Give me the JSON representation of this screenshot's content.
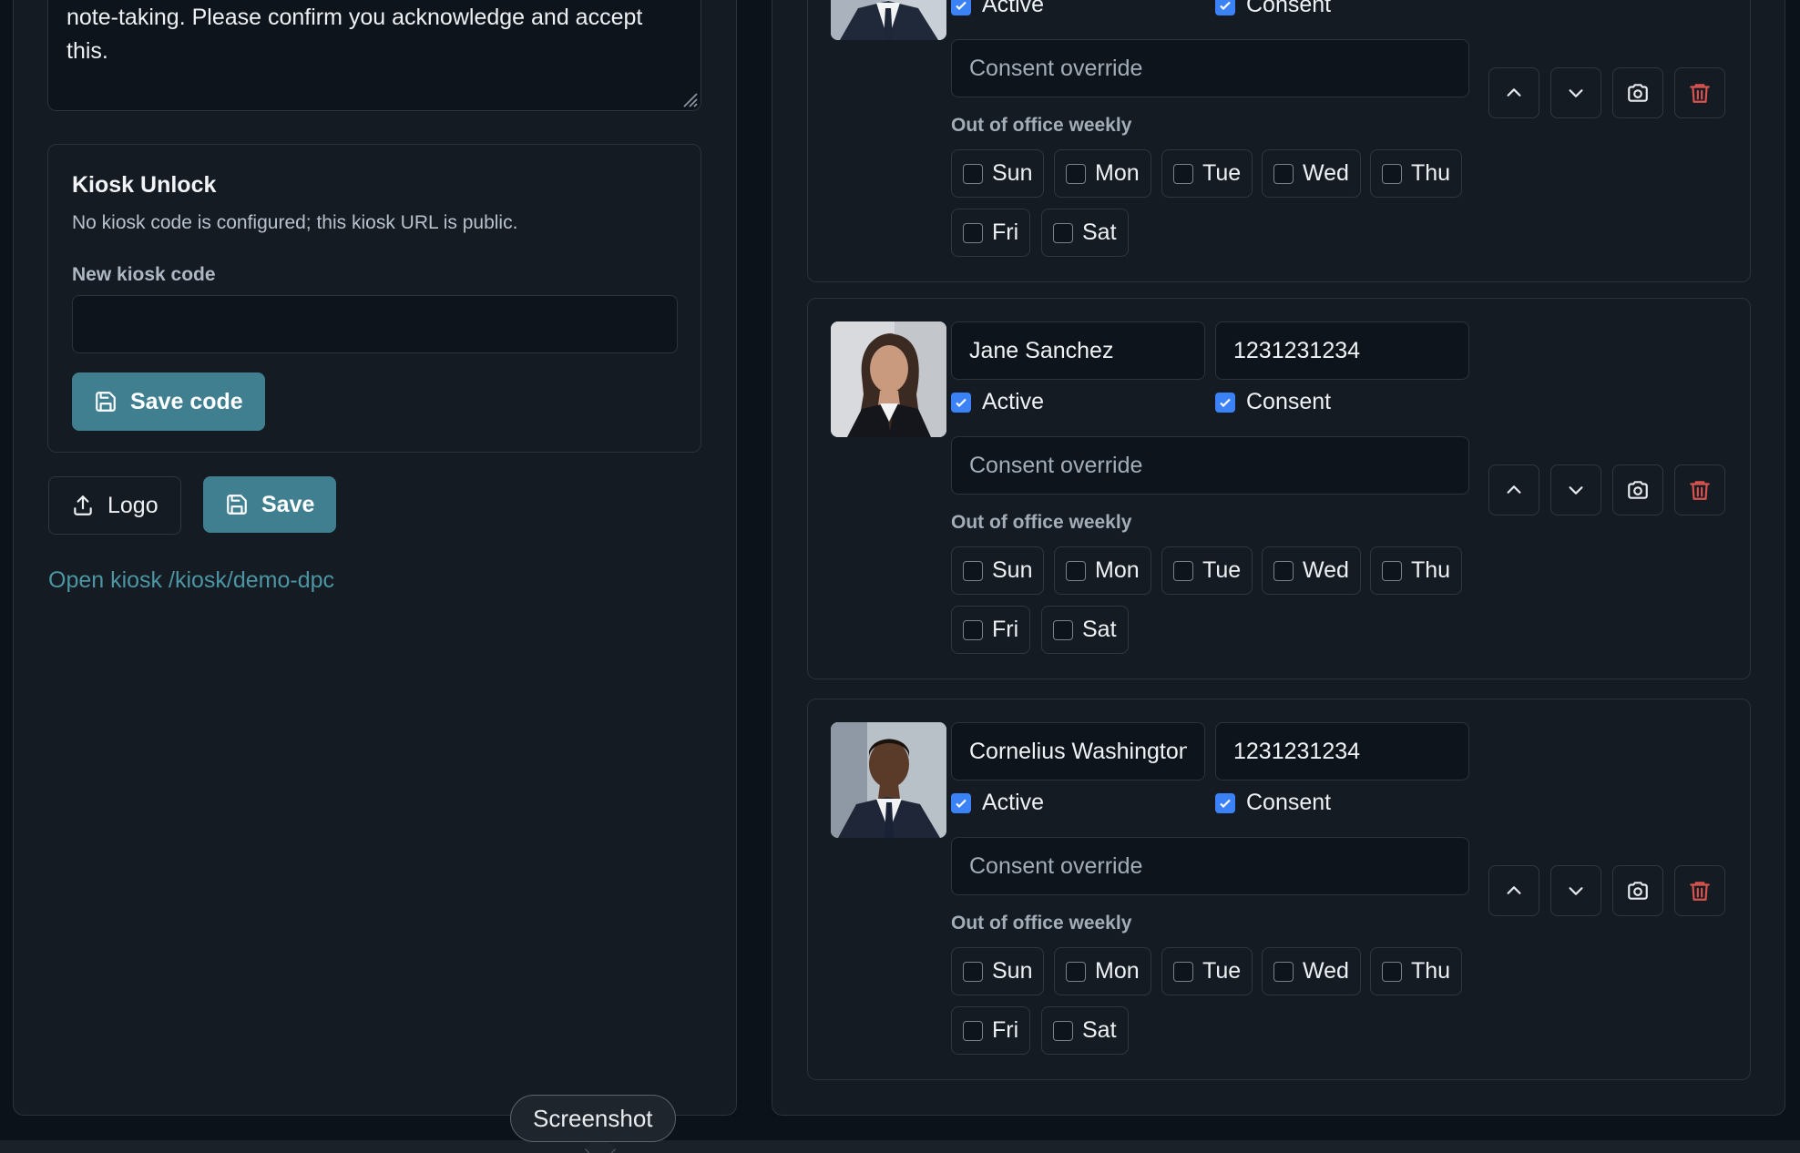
{
  "settings": {
    "note_text": "note-taking. Please confirm you acknowledge and accept this.",
    "kiosk": {
      "title": "Kiosk Unlock",
      "description": "No kiosk code is configured; this kiosk URL is public.",
      "code_label": "New kiosk code",
      "code_value": "",
      "save_code_label": "Save code"
    },
    "logo_label": "Logo",
    "save_label": "Save",
    "open_kiosk_link": "Open kiosk /kiosk/demo-dpc"
  },
  "staff": [
    {
      "name": "",
      "phone": "",
      "active_label": "Active",
      "active": true,
      "consent_label": "Consent",
      "consent": true,
      "consent_override_placeholder": "Consent override",
      "ooo_label": "Out of office weekly",
      "days": [
        "Sun",
        "Mon",
        "Tue",
        "Wed",
        "Thu",
        "Fri",
        "Sat"
      ]
    },
    {
      "name": "Jane Sanchez",
      "phone": "1231231234",
      "active_label": "Active",
      "active": true,
      "consent_label": "Consent",
      "consent": true,
      "consent_override_placeholder": "Consent override",
      "ooo_label": "Out of office weekly",
      "days": [
        "Sun",
        "Mon",
        "Tue",
        "Wed",
        "Thu",
        "Fri",
        "Sat"
      ]
    },
    {
      "name": "Cornelius Washington",
      "phone": "1231231234",
      "active_label": "Active",
      "active": true,
      "consent_label": "Consent",
      "consent": true,
      "consent_override_placeholder": "Consent override",
      "ooo_label": "Out of office weekly",
      "days": [
        "Sun",
        "Mon",
        "Tue",
        "Wed",
        "Thu",
        "Fri",
        "Sat"
      ]
    }
  ],
  "tooltip": {
    "text": "Screenshot"
  },
  "colors": {
    "background": "#0c1219",
    "panel": "#151b23",
    "primary_button": "#3f7f90",
    "link": "#4c95a3",
    "checkbox_checked": "#3b82f6",
    "delete_icon": "#d9534f"
  }
}
